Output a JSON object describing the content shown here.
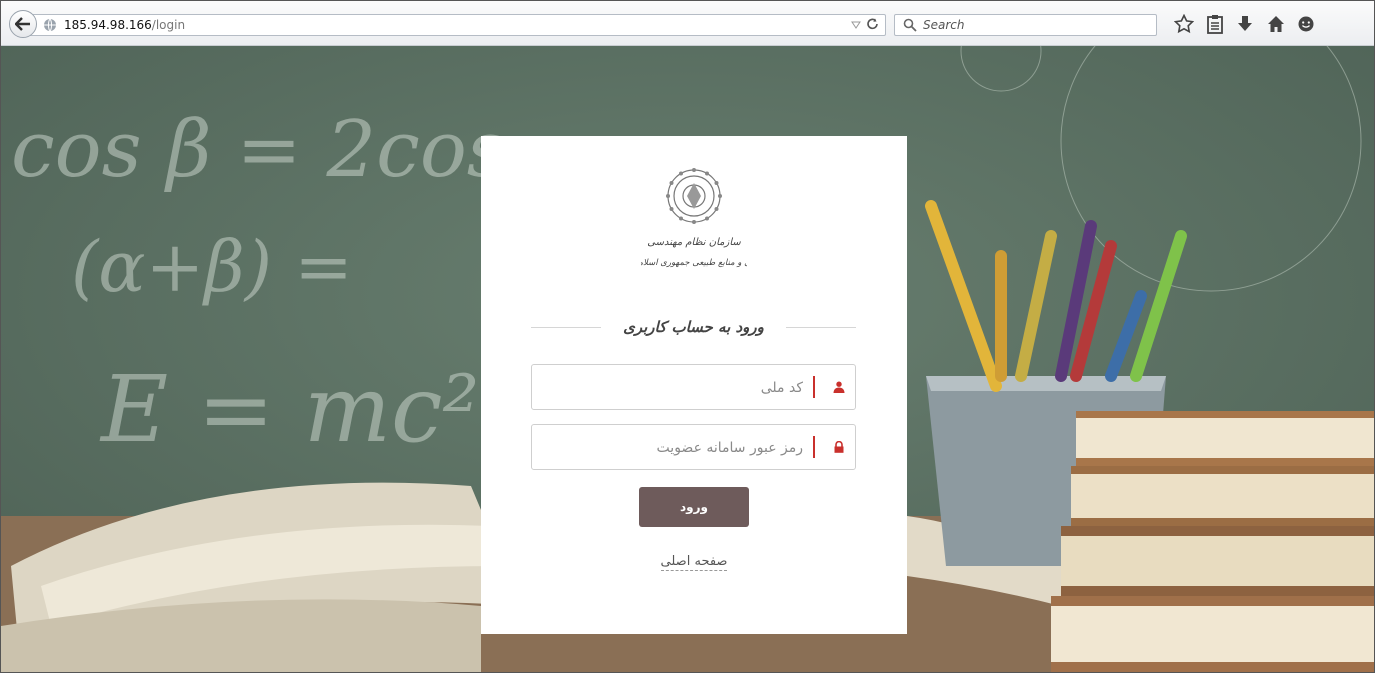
{
  "browser": {
    "url_host": "185.94.98.166",
    "url_path": "/login",
    "search_placeholder": "Search"
  },
  "logo": {
    "line1": "سازمان نظام مهندسی",
    "line2": "کشاورزی و منابع طبیعی جمهوری اسلامی ایران"
  },
  "login": {
    "heading": "ورود به حساب کاربری",
    "username_placeholder": "کد ملی",
    "password_placeholder": "رمز عبور سامانه عضویت",
    "submit_label": "ورود",
    "home_link": "صفحه اصلی"
  },
  "background": {
    "formula1": "cos β = 2cos",
    "formula2": "(α+β) =",
    "formula3": "E = mc²"
  },
  "colors": {
    "accent": "#c9302c",
    "button": "#6e5b5b"
  }
}
